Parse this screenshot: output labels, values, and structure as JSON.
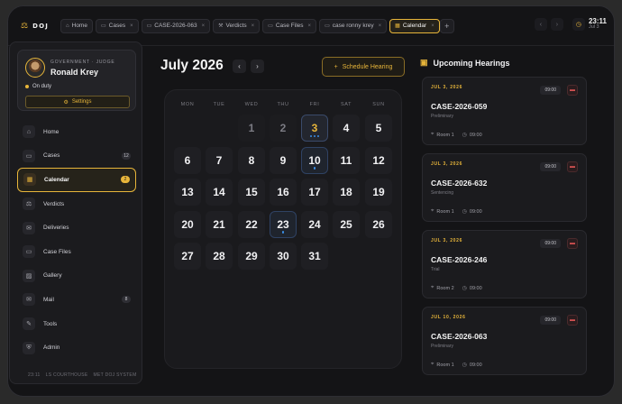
{
  "brand": "DOJ",
  "tabs": [
    {
      "label": "Home",
      "icon": "home-icon",
      "close": false,
      "active": false
    },
    {
      "label": "Cases",
      "icon": "folder-icon",
      "close": true,
      "active": false
    },
    {
      "label": "CASE-2026-063",
      "icon": "folder-icon",
      "close": true,
      "active": false
    },
    {
      "label": "Verdicts",
      "icon": "gavel-icon",
      "close": true,
      "active": false
    },
    {
      "label": "Case Files",
      "icon": "folder-icon",
      "close": true,
      "active": false
    },
    {
      "label": "case ronny krey",
      "icon": "folder-icon",
      "close": true,
      "active": false
    },
    {
      "label": "Calendar",
      "icon": "calendar-icon",
      "close": true,
      "active": true
    }
  ],
  "clock": {
    "time": "23:11",
    "date": "Jul 3"
  },
  "profile": {
    "role": "Government · Judge",
    "name": "Ronald Krey",
    "status": "On duty",
    "settings_label": "Settings"
  },
  "menu": [
    {
      "label": "Home",
      "icon": "home-icon",
      "badge": ""
    },
    {
      "label": "Cases",
      "icon": "folder-icon",
      "badge": "12"
    },
    {
      "label": "Calendar",
      "icon": "calendar-icon",
      "badge": "2",
      "active": true
    },
    {
      "label": "Verdicts",
      "icon": "scales-icon",
      "badge": ""
    },
    {
      "label": "Deliveries",
      "icon": "inbox-icon",
      "badge": ""
    },
    {
      "label": "Case Files",
      "icon": "folder-icon",
      "badge": ""
    },
    {
      "label": "Gallery",
      "icon": "image-icon",
      "badge": ""
    },
    {
      "label": "Mail",
      "icon": "mail-icon",
      "badge": "8"
    },
    {
      "label": "Tools",
      "icon": "wrench-icon",
      "badge": ""
    },
    {
      "label": "Admin",
      "icon": "shield-icon",
      "badge": ""
    }
  ],
  "footer": [
    "23:11",
    "LS COURTHOUSE",
    "MET DOJ SYSTEM"
  ],
  "calendar": {
    "title": "July 2026",
    "schedule_label": "Schedule Hearing",
    "weekdays": [
      "MON",
      "TUE",
      "WED",
      "THU",
      "FRI",
      "SAT",
      "SUN"
    ],
    "weeks": [
      [
        null,
        null,
        {
          "d": "1",
          "muted": true
        },
        {
          "d": "2",
          "muted": true
        },
        {
          "d": "3",
          "today": true,
          "dots": 3
        },
        {
          "d": "4"
        },
        {
          "d": "5"
        }
      ],
      [
        {
          "d": "6"
        },
        {
          "d": "7"
        },
        {
          "d": "8"
        },
        {
          "d": "9"
        },
        {
          "d": "10",
          "event": true,
          "dots": 1
        },
        {
          "d": "11"
        },
        {
          "d": "12"
        }
      ],
      [
        {
          "d": "13"
        },
        {
          "d": "14"
        },
        {
          "d": "15"
        },
        {
          "d": "16"
        },
        {
          "d": "17"
        },
        {
          "d": "18"
        },
        {
          "d": "19"
        }
      ],
      [
        {
          "d": "20"
        },
        {
          "d": "21"
        },
        {
          "d": "22"
        },
        {
          "d": "23",
          "event": true,
          "dots": 1
        },
        {
          "d": "24"
        },
        {
          "d": "25"
        },
        {
          "d": "26"
        }
      ],
      [
        {
          "d": "27"
        },
        {
          "d": "28"
        },
        {
          "d": "29"
        },
        {
          "d": "30"
        },
        {
          "d": "31"
        },
        null,
        null
      ]
    ]
  },
  "hearings_title": "Upcoming Hearings",
  "hearings": [
    {
      "date": "JUL 3, 2026",
      "time": "09:00",
      "case": "CASE-2026-059",
      "type": "Preliminary",
      "room": "Room 1",
      "at": "09:00"
    },
    {
      "date": "JUL 3, 2026",
      "time": "09:00",
      "case": "CASE-2026-632",
      "type": "Sentencing",
      "room": "Room 1",
      "at": "09:00"
    },
    {
      "date": "JUL 3, 2026",
      "time": "09:00",
      "case": "CASE-2026-246",
      "type": "Trial",
      "room": "Room 2",
      "at": "09:00"
    },
    {
      "date": "JUL 10, 2026",
      "time": "09:00",
      "case": "CASE-2026-063",
      "type": "Preliminary",
      "room": "Room 1",
      "at": "09:00"
    }
  ]
}
